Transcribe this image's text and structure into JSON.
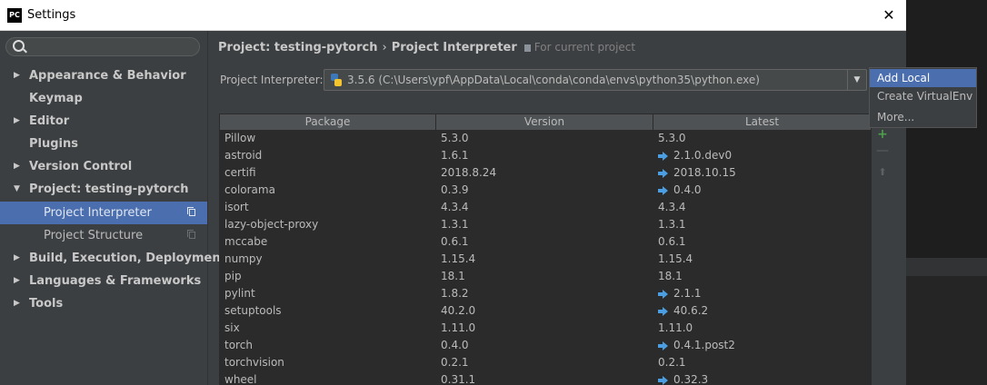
{
  "window": {
    "app_icon": "PC",
    "title": "Settings",
    "close_glyph": "✕"
  },
  "sidebar": {
    "search_icon": "search-icon",
    "items": [
      {
        "label": "Appearance & Behavior",
        "arrow": "▶"
      },
      {
        "label": "Keymap",
        "arrow": ""
      },
      {
        "label": "Editor",
        "arrow": "▶"
      },
      {
        "label": "Plugins",
        "arrow": ""
      },
      {
        "label": "Version Control",
        "arrow": "▶"
      },
      {
        "label": "Project: testing-pytorch",
        "arrow": "▼"
      },
      {
        "label": "Project Interpreter",
        "arrow": ""
      },
      {
        "label": "Project Structure",
        "arrow": ""
      },
      {
        "label": "Build, Execution, Deployment",
        "arrow": "▶"
      },
      {
        "label": "Languages & Frameworks",
        "arrow": "▶"
      },
      {
        "label": "Tools",
        "arrow": "▶"
      }
    ],
    "selected": "Project Interpreter"
  },
  "breadcrumb": {
    "project": "Project: testing-pytorch",
    "separator": "›",
    "page": "Project Interpreter",
    "note": "For current project"
  },
  "interpreter": {
    "label": "Project Interpreter:",
    "value": "3.5.6 (C:\\Users\\ypf\\AppData\\Local\\conda\\conda\\envs\\python35\\python.exe)",
    "dropdown_glyph": "▼"
  },
  "table": {
    "columns": [
      "Package",
      "Version",
      "Latest"
    ],
    "rows": [
      {
        "package": "Pillow",
        "version": "5.3.0",
        "latest": "5.3.0",
        "upgrade": false
      },
      {
        "package": "astroid",
        "version": "1.6.1",
        "latest": "2.1.0.dev0",
        "upgrade": true
      },
      {
        "package": "certifi",
        "version": "2018.8.24",
        "latest": "2018.10.15",
        "upgrade": true
      },
      {
        "package": "colorama",
        "version": "0.3.9",
        "latest": "0.4.0",
        "upgrade": true
      },
      {
        "package": "isort",
        "version": "4.3.4",
        "latest": "4.3.4",
        "upgrade": false
      },
      {
        "package": "lazy-object-proxy",
        "version": "1.3.1",
        "latest": "1.3.1",
        "upgrade": false
      },
      {
        "package": "mccabe",
        "version": "0.6.1",
        "latest": "0.6.1",
        "upgrade": false
      },
      {
        "package": "numpy",
        "version": "1.15.4",
        "latest": "1.15.4",
        "upgrade": false
      },
      {
        "package": "pip",
        "version": "18.1",
        "latest": "18.1",
        "upgrade": false
      },
      {
        "package": "pylint",
        "version": "1.8.2",
        "latest": "2.1.1",
        "upgrade": true
      },
      {
        "package": "setuptools",
        "version": "40.2.0",
        "latest": "40.6.2",
        "upgrade": true
      },
      {
        "package": "six",
        "version": "1.11.0",
        "latest": "1.11.0",
        "upgrade": false
      },
      {
        "package": "torch",
        "version": "0.4.0",
        "latest": "0.4.1.post2",
        "upgrade": true
      },
      {
        "package": "torchvision",
        "version": "0.2.1",
        "latest": "0.2.1",
        "upgrade": false
      },
      {
        "package": "wheel",
        "version": "0.31.1",
        "latest": "0.32.3",
        "upgrade": true
      }
    ]
  },
  "tools": {
    "add": "+",
    "remove": "—",
    "upgrade": "⬆"
  },
  "popup": {
    "items": [
      "Add Local",
      "Create VirtualEnv",
      "More..."
    ],
    "active": "Add Local"
  },
  "colors": {
    "selection": "#4b6eaf",
    "upgrade_arrow": "#4a9ee1",
    "table_bg": "#2b2b2b",
    "panel_bg": "#3c3f41"
  }
}
